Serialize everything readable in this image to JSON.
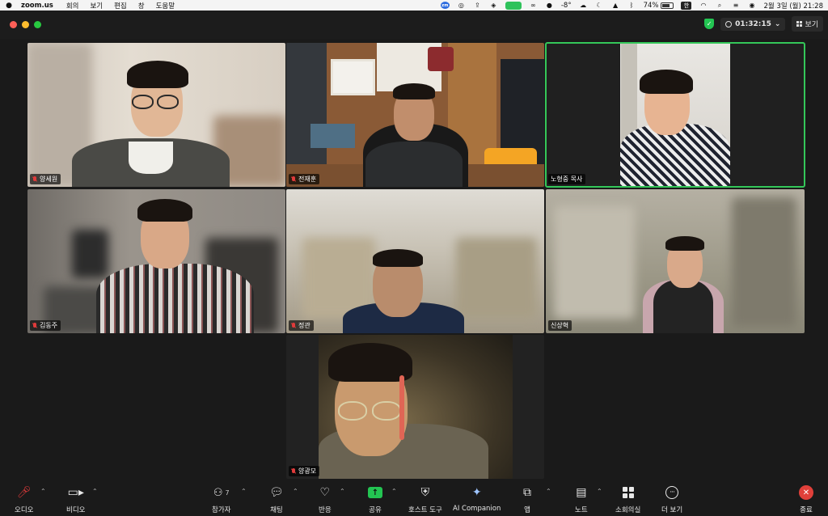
{
  "menubar": {
    "app_name": "zoom.us",
    "menus": [
      "회의",
      "보기",
      "편집",
      "창",
      "도움말"
    ],
    "temperature": "-8°",
    "battery": "74%",
    "battery_level": 0.74,
    "input_source": "한",
    "datetime": "2월 3일 (월) 21:28"
  },
  "window": {
    "timer": "01:32:15",
    "view_label": "보기"
  },
  "participants": [
    {
      "name": "양세원",
      "muted": true
    },
    {
      "name": "전재훈",
      "muted": true
    },
    {
      "name": "노형중 목사",
      "muted": false,
      "active_speaker": true
    },
    {
      "name": "김동주",
      "muted": true
    },
    {
      "name": "정관",
      "muted": true
    },
    {
      "name": "신상혁",
      "muted": false
    },
    {
      "name": "양광모",
      "muted": true
    }
  ],
  "toolbar": {
    "audio": "오디오",
    "video": "비디오",
    "participants": "참가자",
    "participant_count": "7",
    "chat": "채팅",
    "reactions": "반응",
    "share": "공유",
    "host_tools": "호스트 도구",
    "ai_companion": "AI Companion",
    "apps": "앱",
    "notes": "노트",
    "breakout": "소회의실",
    "more": "더 보기",
    "end": "종료"
  },
  "colors": {
    "active_speaker_border": "#34c759",
    "share_green": "#23c552",
    "end_red": "#e0403a",
    "mute_red": "#e03b3b"
  }
}
